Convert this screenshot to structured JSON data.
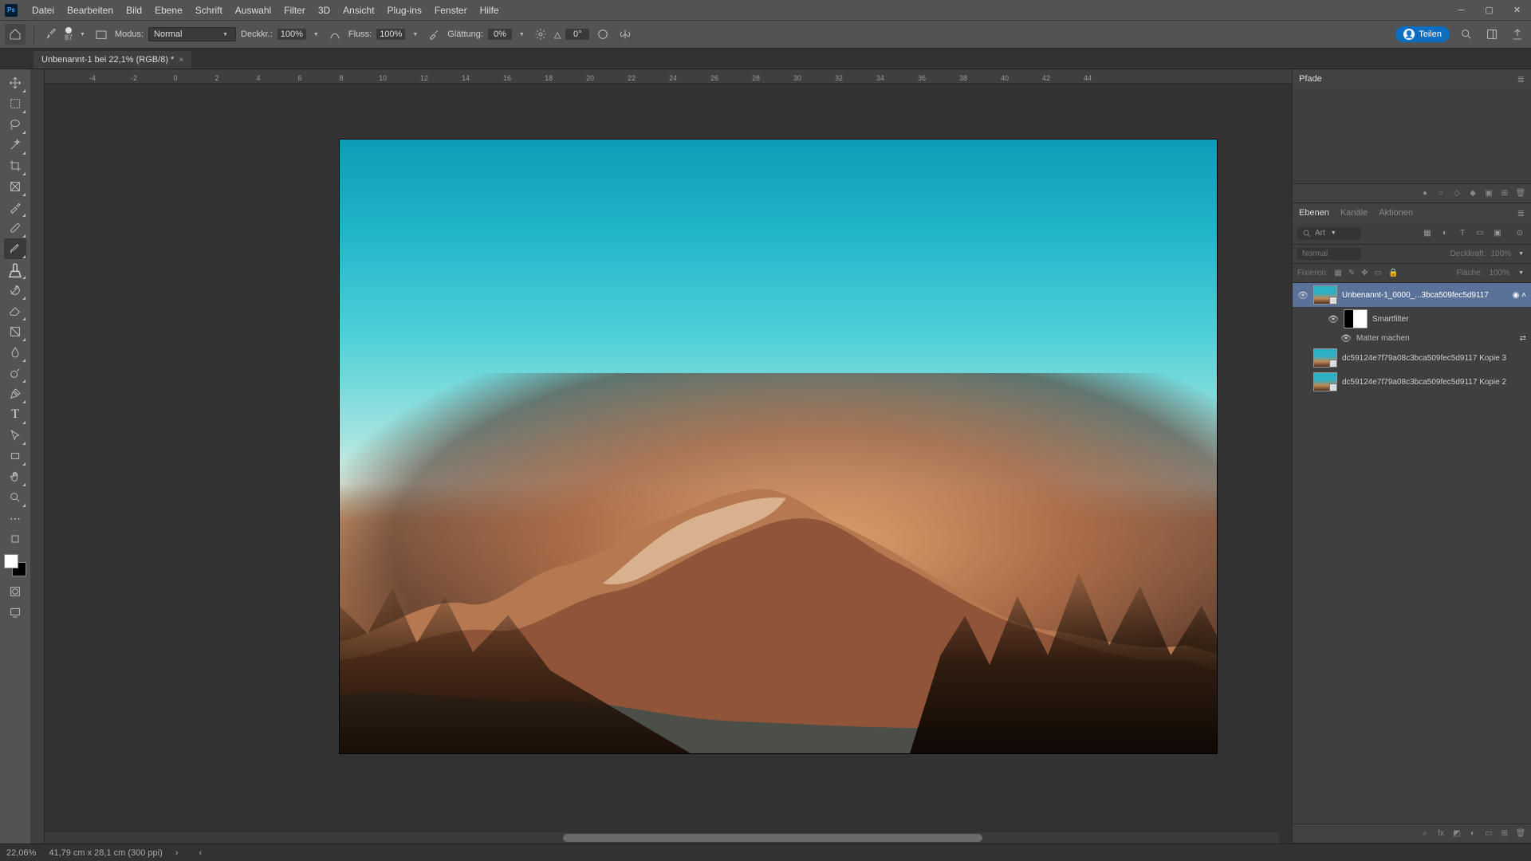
{
  "app": {
    "short": "Ps"
  },
  "menubar": [
    "Datei",
    "Bearbeiten",
    "Bild",
    "Ebene",
    "Schrift",
    "Auswahl",
    "Filter",
    "3D",
    "Ansicht",
    "Plug-ins",
    "Fenster",
    "Hilfe"
  ],
  "options": {
    "brush_size": "87",
    "mode_label": "Modus:",
    "mode_value": "Normal",
    "opacity_label": "Deckkr.:",
    "opacity_value": "100%",
    "flow_label": "Fluss:",
    "flow_value": "100%",
    "smooth_label": "Glättung:",
    "smooth_value": "0%",
    "angle_value": "0°"
  },
  "share_label": "Teilen",
  "doc_tab": "Unbenannt-1 bei 22,1% (RGB/8) *",
  "ruler_h": [
    "-4",
    "-2",
    "0",
    "2",
    "4",
    "6",
    "8",
    "10",
    "12",
    "14",
    "16",
    "18",
    "20",
    "22",
    "24",
    "26",
    "28",
    "30",
    "32",
    "34",
    "36",
    "38",
    "40",
    "42",
    "44"
  ],
  "panels": {
    "paths_tab": "Pfade",
    "layers_tabs": [
      "Ebenen",
      "Kanäle",
      "Aktionen"
    ],
    "search_label": "Art",
    "blend_mode": "Normal",
    "opacity_label2": "Deckkraft:",
    "opacity_val2": "100%",
    "lock_label": "Fixieren:",
    "fill_label": "Fläche:",
    "fill_val": "100%"
  },
  "layers": [
    {
      "name": "Unbenannt-1_0000_...3bca509fec5d9117"
    },
    {
      "name": "Smartfilter"
    },
    {
      "name": "Matter machen"
    },
    {
      "name": "dc59124e7f79a08c3bca509fec5d9117 Kopie 3"
    },
    {
      "name": "dc59124e7f79a08c3bca509fec5d9117 Kopie 2"
    }
  ],
  "status": {
    "zoom": "22,06%",
    "doc_size": "41,79 cm x 28,1 cm (300 ppi)"
  }
}
